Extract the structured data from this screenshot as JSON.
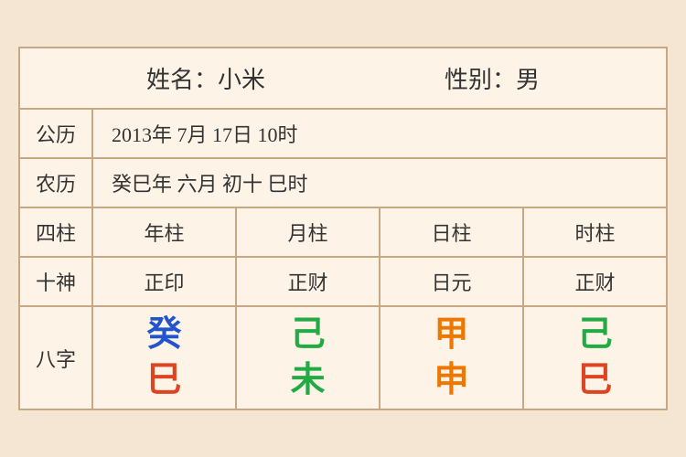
{
  "header": {
    "name_label": "姓名：小米",
    "gender_label": "性别：男"
  },
  "rows": {
    "gregorian_label": "公历",
    "gregorian_value": "2013年 7月 17日 10时",
    "lunar_label": "农历",
    "lunar_value": "癸巳年 六月 初十 巳时"
  },
  "columns": {
    "sizhu_label": "四柱",
    "shishen_label": "十神",
    "bazhi_label": "八字",
    "headers": [
      "年柱",
      "月柱",
      "日柱",
      "时柱"
    ],
    "shishen": [
      "正印",
      "正财",
      "日元",
      "正财"
    ],
    "bazhi_top": [
      "癸",
      "己",
      "甲",
      "己"
    ],
    "bazhi_bottom": [
      "巳",
      "未",
      "申",
      "巳"
    ],
    "bazhi_top_colors": [
      "blue",
      "green",
      "orange",
      "green"
    ],
    "bazhi_bottom_colors": [
      "red",
      "green",
      "orange",
      "red"
    ]
  }
}
